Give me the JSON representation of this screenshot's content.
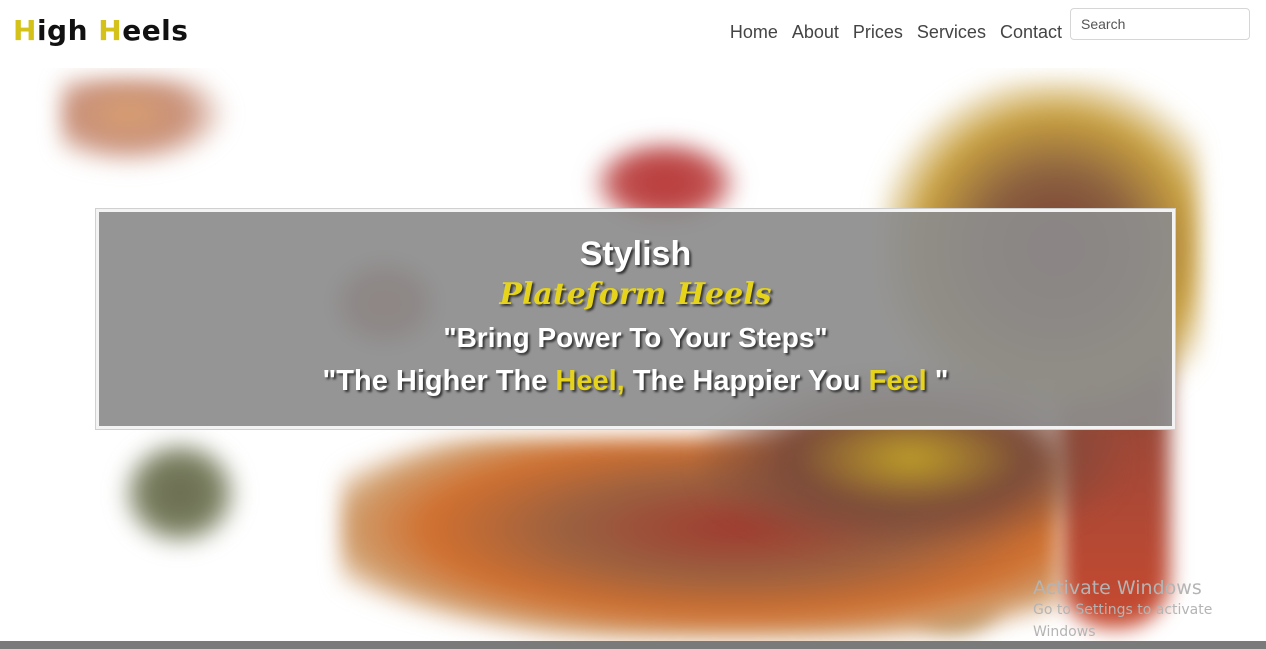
{
  "navbar": {
    "brand": {
      "part1_initial": "H",
      "part1_rest": "igh",
      "part2_initial": "H",
      "part2_rest": "eels"
    },
    "links": [
      "Home",
      "About",
      "Prices",
      "Services",
      "Contact"
    ],
    "search": {
      "placeholder": "Search",
      "value": ""
    }
  },
  "banner": {
    "line1": "Stylish",
    "line2": "Plateform Heels",
    "line3": "\"Bring Power To Your Steps\"",
    "line4": {
      "part1": "\"The Higher The ",
      "highlight1": "Heel,",
      "part2": " The Happier You ",
      "highlight2": "Feel",
      "part3": " \""
    }
  },
  "watermark": {
    "title": "Activate Windows",
    "subtitle": "Go to Settings to activate Windows"
  },
  "colors": {
    "accent_yellow": "#e6d41c",
    "banner_overlay": "#8c8c8c",
    "nav_text": "#444444"
  }
}
